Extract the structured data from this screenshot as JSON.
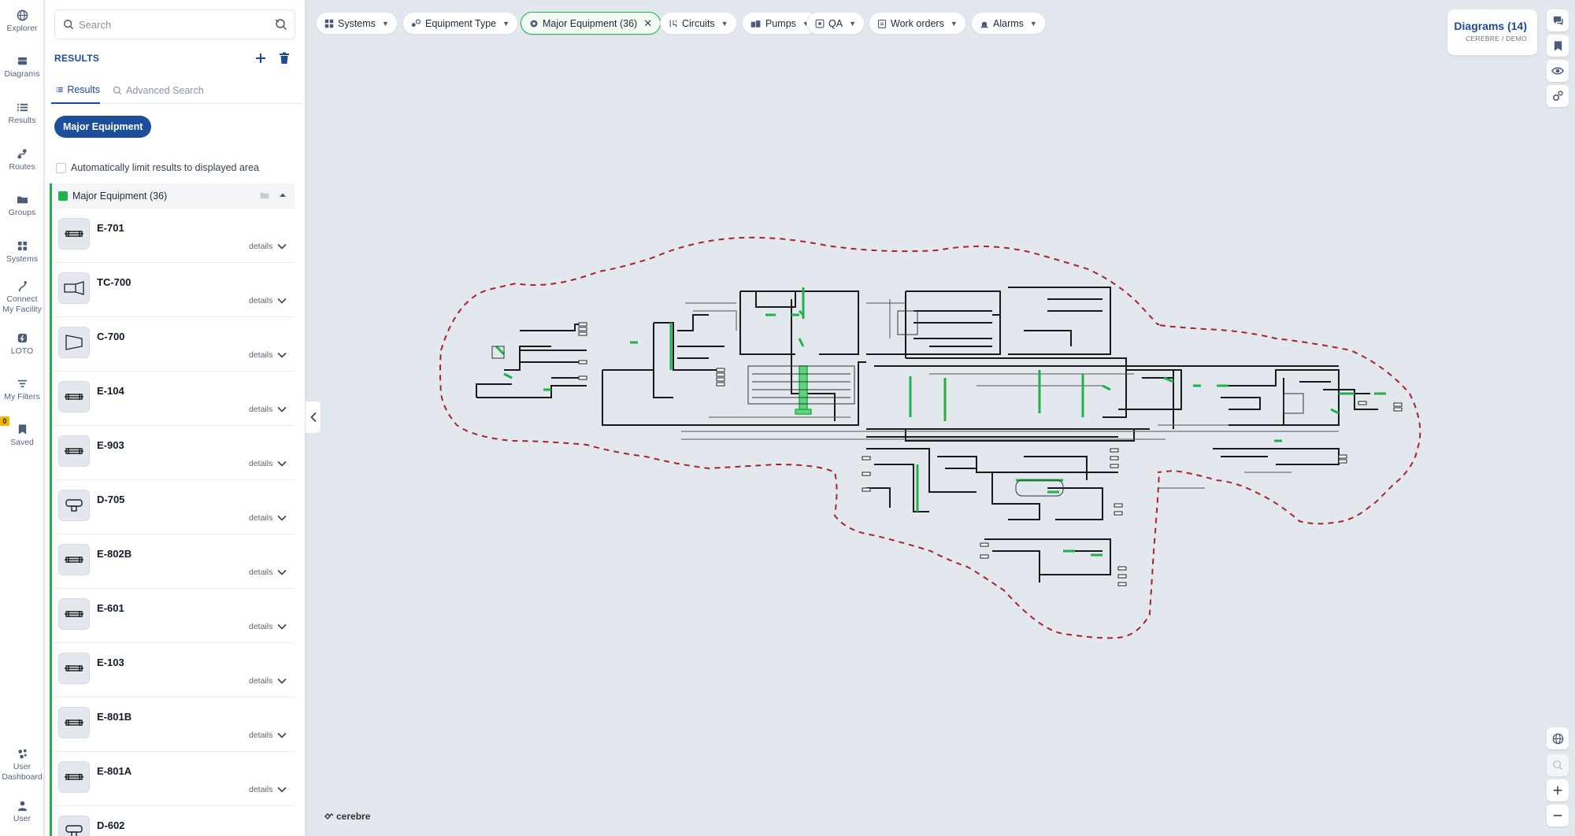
{
  "nav": {
    "items": [
      {
        "label": "Explorer",
        "icon": "globe-icon"
      },
      {
        "label": "Diagrams",
        "icon": "diagram-stack-icon"
      },
      {
        "label": "Results",
        "icon": "list-icon"
      },
      {
        "label": "Routes",
        "icon": "route-icon"
      },
      {
        "label": "Groups",
        "icon": "folder-icon"
      },
      {
        "label": "Systems",
        "icon": "grid-icon"
      },
      {
        "label": "Connect My Facility",
        "line1": "Connect",
        "line2": "My Facility",
        "icon": "connect-icon"
      },
      {
        "label": "LOTO",
        "icon": "lock-tag-icon"
      },
      {
        "label": "My Filters",
        "icon": "filter-icon"
      },
      {
        "label": "Saved",
        "icon": "bookmark-icon",
        "badge": "0"
      },
      {
        "label": "User Dashboard",
        "line1": "User",
        "line2": "Dashboard",
        "icon": "dashboard-icon"
      },
      {
        "label": "User",
        "icon": "user-icon"
      }
    ]
  },
  "panel": {
    "search_placeholder": "Search",
    "results_title": "RESULTS",
    "tabs": {
      "results": "Results",
      "advanced": "Advanced Search"
    },
    "chip": "Major Equipment",
    "limit_label": "Automatically limit results to displayed area",
    "group_title": "Major Equipment (36)",
    "group_color": "#20b14a",
    "details_label": "details",
    "items": [
      {
        "name": "E-701",
        "icon": "heat-exchanger-icon"
      },
      {
        "name": "TC-700",
        "icon": "turbine-compressor-icon"
      },
      {
        "name": "C-700",
        "icon": "compressor-icon"
      },
      {
        "name": "E-104",
        "icon": "heat-exchanger-icon"
      },
      {
        "name": "E-903",
        "icon": "heat-exchanger-icon"
      },
      {
        "name": "D-705",
        "icon": "drum-icon"
      },
      {
        "name": "E-802B",
        "icon": "heat-exchanger-icon"
      },
      {
        "name": "E-601",
        "icon": "heat-exchanger-icon"
      },
      {
        "name": "E-103",
        "icon": "heat-exchanger-icon"
      },
      {
        "name": "E-801B",
        "icon": "heat-exchanger-icon"
      },
      {
        "name": "E-801A",
        "icon": "heat-exchanger-icon"
      },
      {
        "name": "D-602",
        "icon": "drum-icon"
      }
    ]
  },
  "filters": [
    {
      "label": "Systems",
      "icon": "grid-icon"
    },
    {
      "label": "Equipment Type",
      "icon": "equipment-type-icon"
    },
    {
      "label": "Major Equipment (36)",
      "icon": "gear-icon",
      "active": true
    },
    {
      "label": "Circuits",
      "icon": "circuit-icon"
    },
    {
      "label": "Pumps",
      "icon": "pump-icon"
    },
    {
      "label": "QA",
      "icon": "qa-icon"
    },
    {
      "label": "Work orders",
      "icon": "clipboard-icon"
    },
    {
      "label": "Alarms",
      "icon": "alarm-icon"
    }
  ],
  "diagrams_card": {
    "title": "Diagrams (14)",
    "subtitle": "CEREBRE / DEMO"
  },
  "logo": {
    "text": "cerebre"
  },
  "colors": {
    "accent": "#1e4a9b",
    "highlight": "#20b14a",
    "boundary": "#a8232a",
    "canvas": "#e3e8ef"
  }
}
